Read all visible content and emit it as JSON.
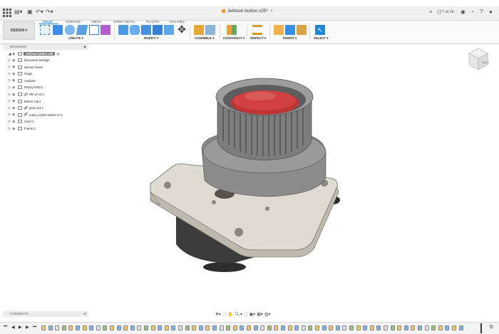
{
  "window": {
    "doc_title": "Jettison button v25*",
    "page_count": "7 of 16"
  },
  "ribbon": {
    "workspace_label": "DESIGN",
    "tabs": [
      "SOLID",
      "SURFACE",
      "MESH",
      "SHEET METAL",
      "PLASTIC",
      "UTILITIES"
    ],
    "active_tab": "SOLID",
    "groups": [
      "CREATE",
      "MODIFY",
      "ASSEMBLE",
      "CONSTRUCT",
      "INSPECT",
      "INSERT",
      "SELECT"
    ]
  },
  "browser": {
    "title": "BROWSER",
    "root": "Jettison button v25",
    "items": [
      {
        "label": "Document Settings",
        "icon": "gear-icon",
        "link": false
      },
      {
        "label": "Named Views",
        "icon": "folder-icon",
        "link": false
      },
      {
        "label": "Origin",
        "icon": "folder-icon",
        "link": false
      },
      {
        "label": "Analysis",
        "icon": "folder-icon",
        "link": false
      },
      {
        "label": "Rotary knob:1",
        "icon": "component-icon",
        "link": false
      },
      {
        "label": "PB-13 v4:1",
        "icon": "component-icon",
        "link": true
      },
      {
        "label": "Button cap:1",
        "icon": "component-icon",
        "link": false
      },
      {
        "label": "gear v12:1",
        "icon": "component-icon",
        "link": true
      },
      {
        "label": "rotary control switch v2:1",
        "icon": "component-icon",
        "link": true
      },
      {
        "label": "Case:1",
        "icon": "component-icon",
        "link": false
      },
      {
        "label": "Frame:1",
        "icon": "component-icon",
        "link": false
      }
    ]
  },
  "comments": {
    "title": "COMMENTS"
  },
  "colors": {
    "accent": "#1e86d6",
    "button_red": "#d24141",
    "body_gray": "#8c8c8c",
    "plate_beige": "#dedbd2"
  }
}
